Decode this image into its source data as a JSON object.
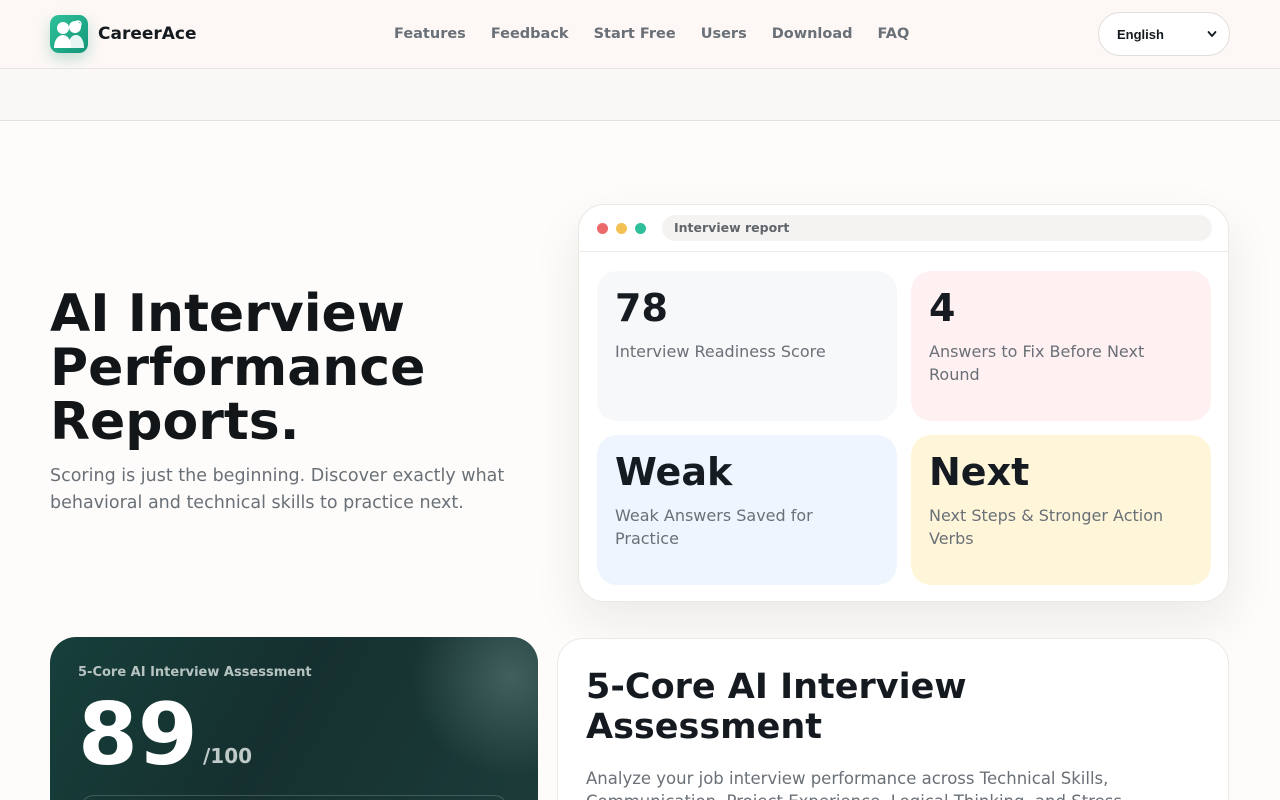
{
  "header": {
    "brand": "CareerAce",
    "nav": [
      "Features",
      "Feedback",
      "Start Free",
      "Users",
      "Download",
      "FAQ"
    ],
    "language": "English"
  },
  "hero": {
    "title": "AI Interview Performance Reports.",
    "subtitle": "Scoring is just the beginning. Discover exactly what behavioral and technical skills to practice next."
  },
  "report": {
    "address": "Interview report",
    "cards": [
      {
        "value": "78",
        "label": "Interview Readiness Score",
        "color": "#f6f8f9"
      },
      {
        "value": "4",
        "label": "Answers to Fix Before Next Round",
        "color": "#fff0f1"
      },
      {
        "value": "Weak",
        "label": "Weak Answers Saved for Practice",
        "color": "#eef5fe"
      },
      {
        "value": "Next",
        "label": "Next Steps & Stronger Action Verbs",
        "color": "#fff6d9"
      }
    ]
  },
  "assessment": {
    "caption": "5-Core AI Interview Assessment",
    "score": "89",
    "out_of": "/100"
  },
  "info": {
    "title": "5-Core AI Interview Assessment",
    "body": "Analyze your job interview performance across Technical Skills, Communication, Project Experience, Logical Thinking, and Stress Tolerance."
  },
  "colors": {
    "accent": "#1fa987",
    "dot_red": "#ec6a6a",
    "dot_yellow": "#f4c154",
    "dot_green": "#2fbf9a"
  }
}
